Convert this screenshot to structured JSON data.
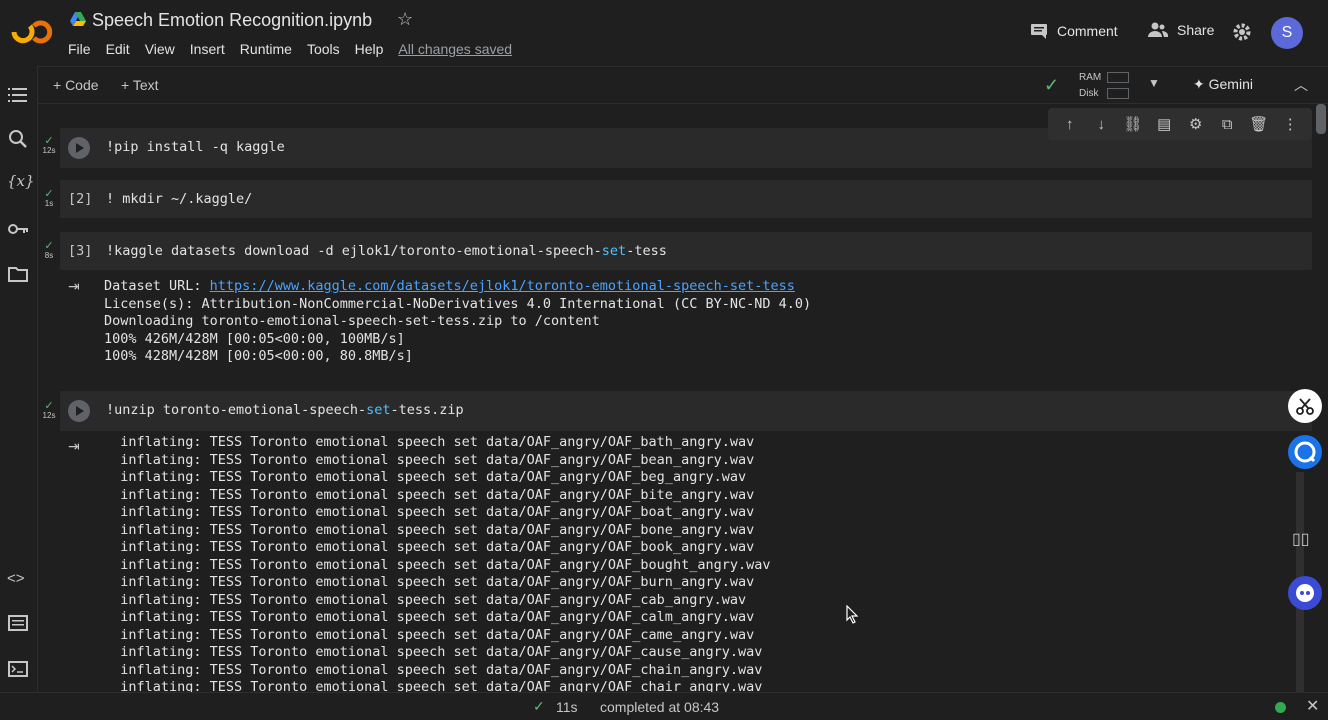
{
  "app": {
    "notebook_title": "Speech Emotion Recognition.ipynb",
    "menu": [
      "File",
      "Edit",
      "View",
      "Insert",
      "Runtime",
      "Tools",
      "Help"
    ],
    "save_status": "All changes saved",
    "comment_label": "Comment",
    "share_label": "Share",
    "avatar_letter": "S"
  },
  "toolbar": {
    "add_code": "+ Code",
    "add_text": "+ Text",
    "ram_label": "RAM",
    "disk_label": "Disk",
    "gemini_label": "Gemini"
  },
  "cells": [
    {
      "exec": "",
      "status_time": "12s",
      "code": "!pip install -q kaggle"
    },
    {
      "exec": "[2]",
      "status_time": "1s",
      "code": "! mkdir ~/.kaggle/"
    },
    {
      "exec": "[3]",
      "status_time": "8s",
      "code_prefix": "!kaggle datasets download -d ejlok1/toronto-emotional-speech-",
      "code_kw": "set",
      "code_suffix": "-tess",
      "output": {
        "url_prefix": "Dataset URL: ",
        "url": "https://www.kaggle.com/datasets/ejlok1/toronto-emotional-speech-set-tess",
        "lines": [
          "License(s): Attribution-NonCommercial-NoDerivatives 4.0 International (CC BY-NC-ND 4.0)",
          "Downloading toronto-emotional-speech-set-tess.zip to /content",
          "100% 426M/428M [00:05<00:00, 100MB/s]",
          "100% 428M/428M [00:05<00:00, 80.8MB/s]"
        ]
      }
    },
    {
      "exec": "",
      "status_time": "12s",
      "code_prefix": "!unzip toronto-emotional-speech-",
      "code_kw": "set",
      "code_suffix": "-tess.zip",
      "output_lines": [
        "  inflating: TESS Toronto emotional speech set data/OAF_angry/OAF_bath_angry.wav",
        "  inflating: TESS Toronto emotional speech set data/OAF_angry/OAF_bean_angry.wav",
        "  inflating: TESS Toronto emotional speech set data/OAF_angry/OAF_beg_angry.wav",
        "  inflating: TESS Toronto emotional speech set data/OAF_angry/OAF_bite_angry.wav",
        "  inflating: TESS Toronto emotional speech set data/OAF_angry/OAF_boat_angry.wav",
        "  inflating: TESS Toronto emotional speech set data/OAF_angry/OAF_bone_angry.wav",
        "  inflating: TESS Toronto emotional speech set data/OAF_angry/OAF_book_angry.wav",
        "  inflating: TESS Toronto emotional speech set data/OAF_angry/OAF_bought_angry.wav",
        "  inflating: TESS Toronto emotional speech set data/OAF_angry/OAF_burn_angry.wav",
        "  inflating: TESS Toronto emotional speech set data/OAF_angry/OAF_cab_angry.wav",
        "  inflating: TESS Toronto emotional speech set data/OAF_angry/OAF_calm_angry.wav",
        "  inflating: TESS Toronto emotional speech set data/OAF_angry/OAF_came_angry.wav",
        "  inflating: TESS Toronto emotional speech set data/OAF_angry/OAF_cause_angry.wav",
        "  inflating: TESS Toronto emotional speech set data/OAF_angry/OAF_chain_angry.wav",
        "  inflating: TESS Toronto emotional speech set data/OAF_angry/OAF_chair_angry.wav"
      ]
    }
  ],
  "statusbar": {
    "check": "✓",
    "elapsed": "11s",
    "completed": "completed at 08:43"
  },
  "colors": {
    "background": "#1f1f1f",
    "cell": "#2a2a2a",
    "success": "#5bb974",
    "link": "#4aa3ff",
    "avatar": "#5b6ad8"
  },
  "icons": [
    "colab-logo",
    "drive-icon",
    "star-icon",
    "comment-icon",
    "share-icon",
    "gear-icon",
    "toc-icon",
    "search-icon",
    "variables-icon",
    "key-icon",
    "folder-icon",
    "code-snippets-icon",
    "command-palette-icon",
    "terminal-icon",
    "play-icon",
    "output-icon",
    "arrow-up-icon",
    "arrow-down-icon",
    "link-icon",
    "comment-cell-icon",
    "cell-settings-icon",
    "mirror-icon",
    "delete-icon",
    "more-vert-icon"
  ]
}
